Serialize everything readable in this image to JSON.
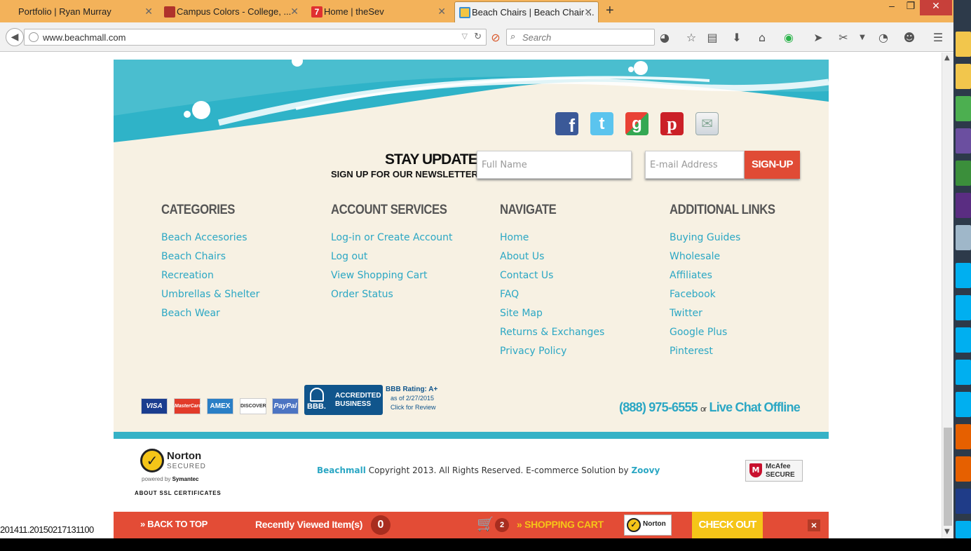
{
  "browser": {
    "tabs": [
      {
        "title": "Portfolio | Ryan Murray",
        "favicon": "none",
        "color": "#f3b25a"
      },
      {
        "title": "Campus Colors - College, ...",
        "favicon": "shield-icon",
        "color": "#b0322b"
      },
      {
        "title": "Home | theSev",
        "favicon": "seven-icon",
        "color": "#e03030"
      },
      {
        "title": "Beach Chairs | Beach Chair ...",
        "favicon": "beach-icon",
        "color": "#3a8fd0"
      }
    ],
    "new_tab": "+",
    "window_controls": {
      "minimize": "–",
      "maximize": "❐",
      "close": "✕"
    },
    "url": "www.beachmall.com",
    "search_placeholder": "Search"
  },
  "footer": {
    "newsletter": {
      "heading": "STAY UPDATED",
      "subheading": "SIGN UP FOR OUR NEWSLETTER",
      "name_placeholder": "Full Name",
      "email_placeholder": "E-mail Address",
      "signup_label": "SIGN-UP"
    },
    "social_icons": [
      "facebook-icon",
      "twitter-icon",
      "google-icon",
      "pinterest-icon",
      "email-icon"
    ],
    "columns": [
      {
        "heading": "CATEGORIES",
        "links": [
          "Beach Accesories",
          "Beach Chairs",
          "Recreation",
          "Umbrellas & Shelter",
          "Beach Wear"
        ]
      },
      {
        "heading": "ACCOUNT SERVICES",
        "links": [
          "Log-in or Create Account",
          "Log out",
          "View Shopping Cart",
          "Order Status"
        ]
      },
      {
        "heading": "NAVIGATE",
        "links": [
          "Home",
          "About Us",
          "Contact Us",
          "FAQ",
          "Site Map",
          "Returns & Exchanges",
          "Privacy Policy"
        ]
      },
      {
        "heading": "ADDITIONAL LINKS",
        "links": [
          "Buying Guides",
          "Wholesale",
          "Affiliates",
          "Facebook",
          "Twitter",
          "Google Plus",
          "Pinterest"
        ]
      }
    ],
    "payment_cards": [
      "VISA",
      "MasterCard",
      "AMEX",
      "DISCOVER",
      "PayPal"
    ],
    "bbb": {
      "badge_line1": "ACCREDITED",
      "badge_line2": "BUSINESS",
      "logo": "BBB.",
      "rating": "BBB Rating: A+",
      "as_of": "as of 2/27/2015",
      "click": "Click for Review"
    },
    "phone": "(888) 975-6555",
    "or": "or",
    "live_chat": "Live Chat Offline"
  },
  "copyright": {
    "norton": "Norton",
    "secured": "SECURED",
    "powered_by": "powered by",
    "symantec": "Symantec",
    "about_ssl": "ABOUT SSL CERTIFICATES",
    "brand": "Beachmall",
    "text": " Copyright 2013. All Rights Reserved. E-commerce Solution by ",
    "vendor": "Zoovy",
    "mcafee": "McAfee",
    "mcafee_secure": "SECURE"
  },
  "sticky_bar": {
    "back_to_top": "» BACK TO TOP",
    "recently_viewed": "Recently Viewed Item(s)",
    "recently_count": "0",
    "cart_count": "2",
    "shopping_cart": "» SHOPPING CART",
    "checkout": "CHECK OUT",
    "close": "×",
    "norton_mini": "Norton"
  },
  "status_text": "201411.20150217131100",
  "colors": {
    "teal": "#2ba7c4",
    "red": "#e34c36",
    "cream": "#f7f1e3",
    "yellow": "#f5c518"
  }
}
